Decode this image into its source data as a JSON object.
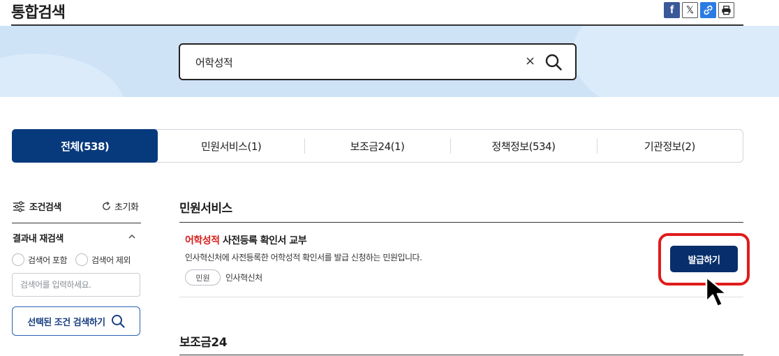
{
  "header": {
    "title": "통합검색",
    "share": {
      "facebook": "f",
      "x": "𝕏"
    }
  },
  "search": {
    "query": "어학성적",
    "clear_label": "×"
  },
  "tabs": [
    {
      "label": "전체(538)",
      "active": true
    },
    {
      "label": "민원서비스(1)"
    },
    {
      "label": "보조금24(1)"
    },
    {
      "label": "정책정보(534)"
    },
    {
      "label": "기관정보(2)"
    }
  ],
  "filter": {
    "title": "조건검색",
    "reset_label": "초기화",
    "refine_title": "결과내 재검색",
    "include_label": "검색어 포함",
    "exclude_label": "검색어 제외",
    "input_placeholder": "검색어를 입력하세요.",
    "apply_label": "선택된 조건 검색하기"
  },
  "sections": [
    {
      "title": "민원서비스",
      "results": [
        {
          "title_highlight": "어학성적",
          "title_rest": " 사전등록 확인서 교부",
          "description": "인사혁신처에 사전등록한 어학성적 확인서를 발급 신청하는 민원입니다.",
          "badge": "민원",
          "org": "인사혁신처",
          "action_label": "발급하기"
        }
      ]
    },
    {
      "title": "보조금24"
    }
  ],
  "colors": {
    "primary": "#063a7d",
    "highlight": "#d7201b",
    "annotation": "#e01b1b",
    "banner": "#cfe3f7"
  }
}
